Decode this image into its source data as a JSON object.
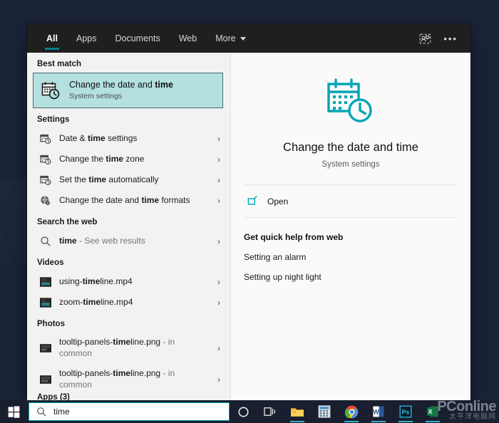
{
  "desktop": {
    "background_color": "#1b2338"
  },
  "search_panel": {
    "tabs": [
      {
        "label": "All",
        "active": true
      },
      {
        "label": "Apps",
        "active": false
      },
      {
        "label": "Documents",
        "active": false
      },
      {
        "label": "Web",
        "active": false
      },
      {
        "label": "More",
        "active": false,
        "has_caret": true
      }
    ],
    "accent_color": "#00838f",
    "header_buttons": [
      {
        "name": "feedback-icon",
        "label": ""
      },
      {
        "name": "more-options-icon",
        "label": "•••"
      }
    ],
    "groups": {
      "best_match": {
        "header": "Best match",
        "item": {
          "title_prefix": "Change the date and ",
          "title_bold": "time",
          "subtitle": "System settings",
          "icon": "calendar-clock-icon",
          "highlight_color": "#b4e0e0"
        }
      },
      "settings": {
        "header": "Settings",
        "items": [
          {
            "pre": "Date & ",
            "bold": "time",
            "post": " settings",
            "icon": "calendar-clock-icon"
          },
          {
            "pre": "Change the ",
            "bold": "time",
            "post": " zone",
            "icon": "calendar-clock-icon"
          },
          {
            "pre": "Set the ",
            "bold": "time",
            "post": " automatically",
            "icon": "calendar-clock-icon"
          },
          {
            "pre": "Change the date and ",
            "bold": "time",
            "post": " formats",
            "icon": "globe-settings-icon"
          }
        ]
      },
      "search_the_web": {
        "header": "Search the web",
        "items": [
          {
            "pre": "",
            "bold": "time",
            "post": " - See web results",
            "icon": "search-icon"
          }
        ]
      },
      "videos": {
        "header": "Videos",
        "items": [
          {
            "pre": "using-",
            "bold": "time",
            "post": "line.mp4",
            "icon": "video-thumbnail-icon"
          },
          {
            "pre": "zoom-",
            "bold": "time",
            "post": "line.mp4",
            "icon": "video-thumbnail-icon"
          }
        ]
      },
      "photos": {
        "header": "Photos",
        "items": [
          {
            "pre": "tooltip-panels-",
            "bold": "time",
            "post": "line.png",
            "location": " - in",
            "location2": "common",
            "icon": "photo-thumbnail-icon"
          },
          {
            "pre": "tooltip-panels-",
            "bold": "time",
            "post": "line.png",
            "location": " - in",
            "location2": "common",
            "icon": "photo-thumbnail-icon"
          }
        ]
      },
      "clipped": {
        "header": "Apps (3)"
      }
    },
    "preview": {
      "icon": "calendar-clock-icon-large",
      "title": "Change the date and time",
      "subtitle": "System settings",
      "open_action": {
        "label": "Open",
        "icon": "open-external-icon"
      },
      "help_header": "Get quick help from web",
      "help_links": [
        "Setting an alarm",
        "Setting up night light"
      ]
    }
  },
  "taskbar": {
    "start_button": "windows-logo-icon",
    "search": {
      "value": "time",
      "icon": "search-icon"
    },
    "items": [
      {
        "name": "cortana-icon"
      },
      {
        "name": "task-view-icon"
      },
      {
        "name": "file-explorer-icon"
      },
      {
        "name": "calculator-icon"
      },
      {
        "name": "chrome-icon"
      },
      {
        "name": "word-icon"
      },
      {
        "name": "photoshop-icon"
      },
      {
        "name": "excel-icon"
      }
    ],
    "watermark": {
      "main": "PConline",
      "sub": "太平洋电脑网"
    }
  }
}
